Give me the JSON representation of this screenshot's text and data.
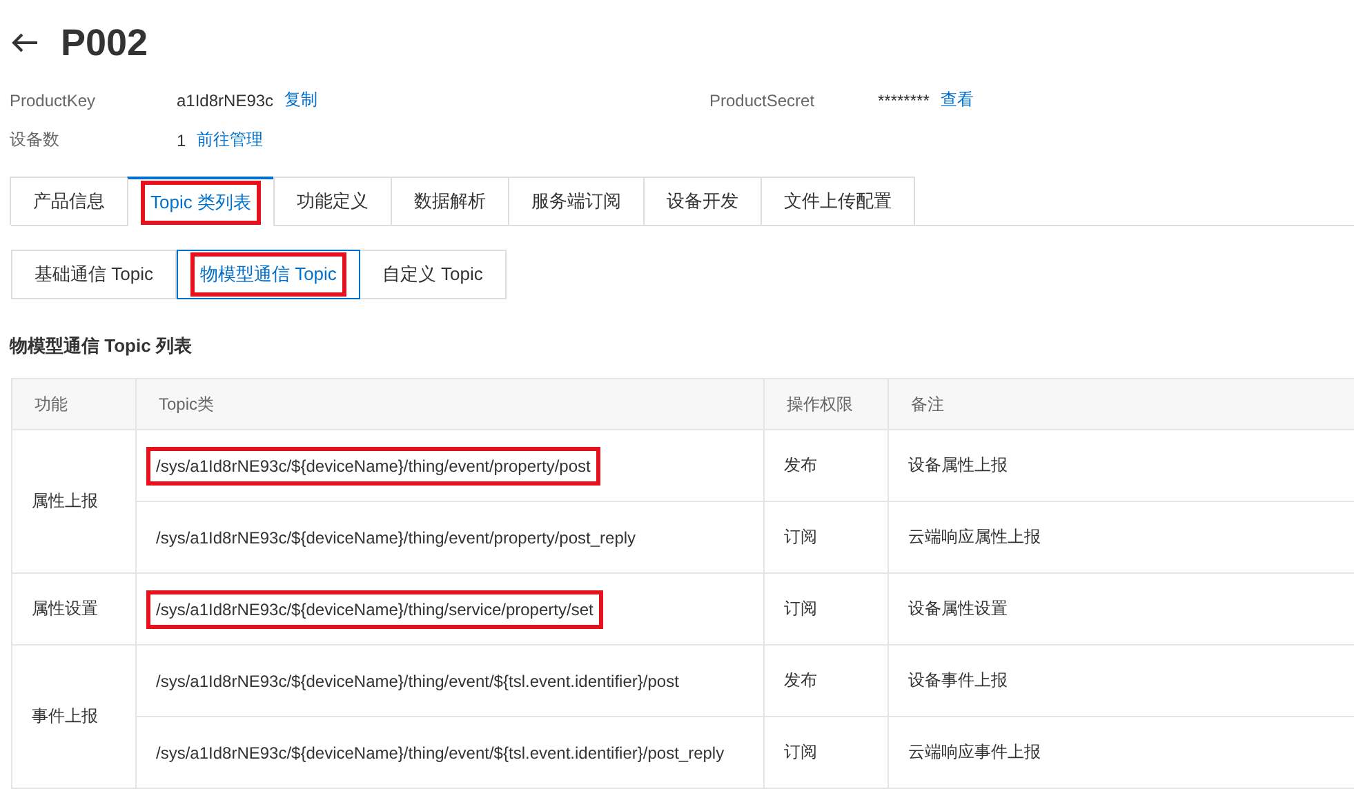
{
  "title": "P002",
  "info": [
    {
      "label": "ProductKey",
      "value": "a1Id8rNE93c",
      "link": "复制"
    },
    {
      "label": "ProductSecret",
      "value": "********",
      "link": "查看"
    },
    {
      "label": "设备数",
      "value": "1",
      "link": "前往管理"
    }
  ],
  "tabs": [
    {
      "label": "产品信息",
      "selected": false,
      "highlighted": false
    },
    {
      "label": "Topic 类列表",
      "selected": true,
      "highlighted": true
    },
    {
      "label": "功能定义",
      "selected": false,
      "highlighted": false
    },
    {
      "label": "数据解析",
      "selected": false,
      "highlighted": false
    },
    {
      "label": "服务端订阅",
      "selected": false,
      "highlighted": false
    },
    {
      "label": "设备开发",
      "selected": false,
      "highlighted": false
    },
    {
      "label": "文件上传配置",
      "selected": false,
      "highlighted": false
    }
  ],
  "subtabs": [
    {
      "label": "基础通信 Topic",
      "selected": false,
      "highlighted": false
    },
    {
      "label": "物模型通信 Topic",
      "selected": true,
      "highlighted": true
    },
    {
      "label": "自定义 Topic",
      "selected": false,
      "highlighted": false
    }
  ],
  "section_title": "物模型通信 Topic 列表",
  "table": {
    "columns": [
      "功能",
      "Topic类",
      "操作权限",
      "备注"
    ],
    "groups": [
      {
        "function": "属性上报",
        "rows": [
          {
            "topic": "/sys/a1Id8rNE93c/${deviceName}/thing/event/property/post",
            "permission": "发布",
            "note": "设备属性上报",
            "highlighted": true
          },
          {
            "topic": "/sys/a1Id8rNE93c/${deviceName}/thing/event/property/post_reply",
            "permission": "订阅",
            "note": "云端响应属性上报",
            "highlighted": false
          }
        ]
      },
      {
        "function": "属性设置",
        "rows": [
          {
            "topic": "/sys/a1Id8rNE93c/${deviceName}/thing/service/property/set",
            "permission": "订阅",
            "note": "设备属性设置",
            "highlighted": true
          }
        ]
      },
      {
        "function": "事件上报",
        "rows": [
          {
            "topic": "/sys/a1Id8rNE93c/${deviceName}/thing/event/${tsl.event.identifier}/post",
            "permission": "发布",
            "note": "设备事件上报",
            "highlighted": false
          },
          {
            "topic": "/sys/a1Id8rNE93c/${deviceName}/thing/event/${tsl.event.identifier}/post_reply",
            "permission": "订阅",
            "note": "云端响应事件上报",
            "highlighted": false
          }
        ]
      }
    ]
  }
}
